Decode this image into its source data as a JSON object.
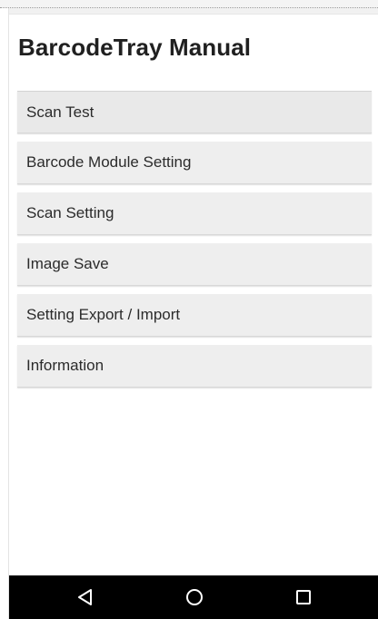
{
  "header": {
    "title": "BarcodeTray Manual"
  },
  "menu": {
    "items": [
      {
        "label": "Scan Test"
      },
      {
        "label": "Barcode Module Setting"
      },
      {
        "label": "Scan Setting"
      },
      {
        "label": "Image Save"
      },
      {
        "label": "Setting Export / Import"
      },
      {
        "label": "Information"
      }
    ]
  },
  "nav": {
    "back_icon": "back-triangle-icon",
    "home_icon": "home-circle-icon",
    "recents_icon": "recents-square-icon",
    "bar_color": "#000000",
    "icon_color": "#ffffff"
  },
  "colors": {
    "item_background": "#eeeeee",
    "title_text": "#202020"
  }
}
